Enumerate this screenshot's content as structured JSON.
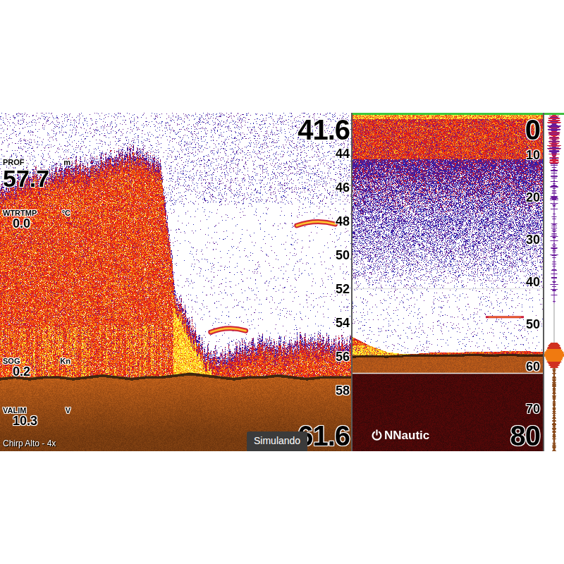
{
  "zoom": {
    "range_top": "41.6",
    "range_bottom": "61.6",
    "ticks": [
      "44",
      "46",
      "48",
      "50",
      "52",
      "54",
      "56",
      "58"
    ],
    "readouts": [
      {
        "label": "PROF",
        "unit": "m",
        "value": "57.7"
      },
      {
        "label": "WTRTMP",
        "unit": "°C",
        "value": "0.0"
      },
      {
        "label": "SOG",
        "unit": "Kn",
        "value": "0.2"
      },
      {
        "label": "VALIM",
        "unit": "V",
        "value": "10.3"
      }
    ],
    "mode": "Chirp Alto - 4x",
    "bottom_depth": [
      57.3,
      57.2,
      57.3,
      57.2,
      57.2,
      57.3,
      57.2,
      57.1,
      57.2,
      57.3,
      57.2,
      57.2,
      57.1,
      57.0,
      57.1,
      57.2,
      57.3,
      57.2,
      57.2,
      57.1,
      57.2,
      57.3,
      57.2,
      57.2,
      57.2
    ],
    "clutter_top": [
      46.0,
      45.5,
      45.0,
      45.2,
      44.8,
      44.5,
      44.6,
      44.2,
      44.0,
      43.8,
      44.1,
      44.6,
      52.0,
      53.8,
      55.5,
      55.8,
      55.5,
      55.2,
      55.0,
      55.2,
      55.0,
      54.8,
      54.9,
      55.0,
      55.0
    ],
    "fish": [
      {
        "x": 0.9,
        "depth": 48.1,
        "length": 0.11
      },
      {
        "x": 0.65,
        "depth": 54.4,
        "length": 0.1
      }
    ]
  },
  "status": "Simulando",
  "overview": {
    "range_top": "0",
    "range_bottom": "80",
    "ticks": [
      "10",
      "20",
      "30",
      "40",
      "50",
      "60",
      "70"
    ],
    "logo": "NNautic",
    "bottom_depth": [
      57.5,
      57.4,
      57.5,
      57.3,
      57.2,
      57.3,
      57.2,
      57.1,
      57.2,
      57.1,
      57.2,
      57.2
    ],
    "clutter_top": [
      53.0,
      55.0,
      56.5,
      57.0,
      56.8,
      56.5,
      56.6,
      56.4,
      56.5,
      56.2,
      56.3,
      56.4
    ],
    "fish": [
      {
        "x": 0.8,
        "depth": 48.3,
        "length": 0.2
      }
    ]
  }
}
